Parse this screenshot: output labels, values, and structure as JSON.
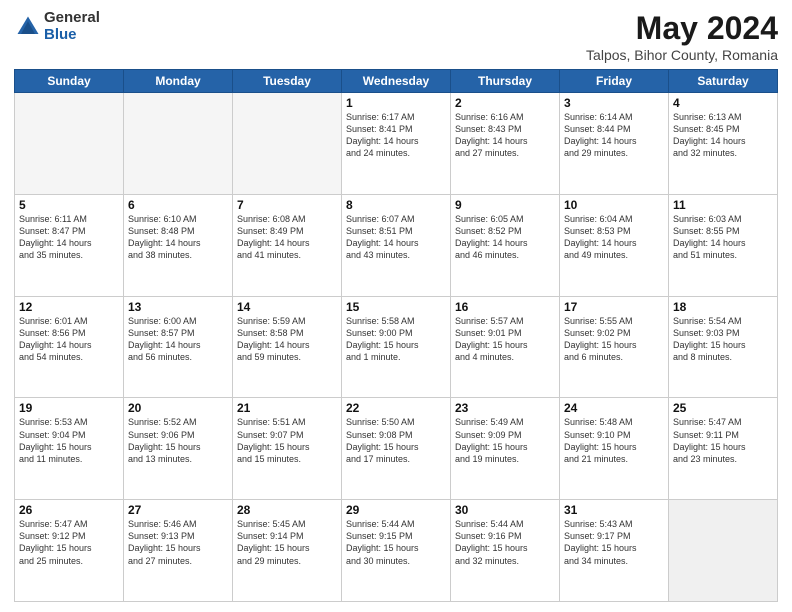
{
  "header": {
    "logo": {
      "general": "General",
      "blue": "Blue"
    },
    "title": "May 2024",
    "location": "Talpos, Bihor County, Romania"
  },
  "weekdays": [
    "Sunday",
    "Monday",
    "Tuesday",
    "Wednesday",
    "Thursday",
    "Friday",
    "Saturday"
  ],
  "weeks": [
    [
      {
        "day": "",
        "info": "",
        "empty": true
      },
      {
        "day": "",
        "info": "",
        "empty": true
      },
      {
        "day": "",
        "info": "",
        "empty": true
      },
      {
        "day": "1",
        "info": "Sunrise: 6:17 AM\nSunset: 8:41 PM\nDaylight: 14 hours\nand 24 minutes.",
        "empty": false
      },
      {
        "day": "2",
        "info": "Sunrise: 6:16 AM\nSunset: 8:43 PM\nDaylight: 14 hours\nand 27 minutes.",
        "empty": false
      },
      {
        "day": "3",
        "info": "Sunrise: 6:14 AM\nSunset: 8:44 PM\nDaylight: 14 hours\nand 29 minutes.",
        "empty": false
      },
      {
        "day": "4",
        "info": "Sunrise: 6:13 AM\nSunset: 8:45 PM\nDaylight: 14 hours\nand 32 minutes.",
        "empty": false
      }
    ],
    [
      {
        "day": "5",
        "info": "Sunrise: 6:11 AM\nSunset: 8:47 PM\nDaylight: 14 hours\nand 35 minutes.",
        "empty": false
      },
      {
        "day": "6",
        "info": "Sunrise: 6:10 AM\nSunset: 8:48 PM\nDaylight: 14 hours\nand 38 minutes.",
        "empty": false
      },
      {
        "day": "7",
        "info": "Sunrise: 6:08 AM\nSunset: 8:49 PM\nDaylight: 14 hours\nand 41 minutes.",
        "empty": false
      },
      {
        "day": "8",
        "info": "Sunrise: 6:07 AM\nSunset: 8:51 PM\nDaylight: 14 hours\nand 43 minutes.",
        "empty": false
      },
      {
        "day": "9",
        "info": "Sunrise: 6:05 AM\nSunset: 8:52 PM\nDaylight: 14 hours\nand 46 minutes.",
        "empty": false
      },
      {
        "day": "10",
        "info": "Sunrise: 6:04 AM\nSunset: 8:53 PM\nDaylight: 14 hours\nand 49 minutes.",
        "empty": false
      },
      {
        "day": "11",
        "info": "Sunrise: 6:03 AM\nSunset: 8:55 PM\nDaylight: 14 hours\nand 51 minutes.",
        "empty": false
      }
    ],
    [
      {
        "day": "12",
        "info": "Sunrise: 6:01 AM\nSunset: 8:56 PM\nDaylight: 14 hours\nand 54 minutes.",
        "empty": false
      },
      {
        "day": "13",
        "info": "Sunrise: 6:00 AM\nSunset: 8:57 PM\nDaylight: 14 hours\nand 56 minutes.",
        "empty": false
      },
      {
        "day": "14",
        "info": "Sunrise: 5:59 AM\nSunset: 8:58 PM\nDaylight: 14 hours\nand 59 minutes.",
        "empty": false
      },
      {
        "day": "15",
        "info": "Sunrise: 5:58 AM\nSunset: 9:00 PM\nDaylight: 15 hours\nand 1 minute.",
        "empty": false
      },
      {
        "day": "16",
        "info": "Sunrise: 5:57 AM\nSunset: 9:01 PM\nDaylight: 15 hours\nand 4 minutes.",
        "empty": false
      },
      {
        "day": "17",
        "info": "Sunrise: 5:55 AM\nSunset: 9:02 PM\nDaylight: 15 hours\nand 6 minutes.",
        "empty": false
      },
      {
        "day": "18",
        "info": "Sunrise: 5:54 AM\nSunset: 9:03 PM\nDaylight: 15 hours\nand 8 minutes.",
        "empty": false
      }
    ],
    [
      {
        "day": "19",
        "info": "Sunrise: 5:53 AM\nSunset: 9:04 PM\nDaylight: 15 hours\nand 11 minutes.",
        "empty": false
      },
      {
        "day": "20",
        "info": "Sunrise: 5:52 AM\nSunset: 9:06 PM\nDaylight: 15 hours\nand 13 minutes.",
        "empty": false
      },
      {
        "day": "21",
        "info": "Sunrise: 5:51 AM\nSunset: 9:07 PM\nDaylight: 15 hours\nand 15 minutes.",
        "empty": false
      },
      {
        "day": "22",
        "info": "Sunrise: 5:50 AM\nSunset: 9:08 PM\nDaylight: 15 hours\nand 17 minutes.",
        "empty": false
      },
      {
        "day": "23",
        "info": "Sunrise: 5:49 AM\nSunset: 9:09 PM\nDaylight: 15 hours\nand 19 minutes.",
        "empty": false
      },
      {
        "day": "24",
        "info": "Sunrise: 5:48 AM\nSunset: 9:10 PM\nDaylight: 15 hours\nand 21 minutes.",
        "empty": false
      },
      {
        "day": "25",
        "info": "Sunrise: 5:47 AM\nSunset: 9:11 PM\nDaylight: 15 hours\nand 23 minutes.",
        "empty": false
      }
    ],
    [
      {
        "day": "26",
        "info": "Sunrise: 5:47 AM\nSunset: 9:12 PM\nDaylight: 15 hours\nand 25 minutes.",
        "empty": false
      },
      {
        "day": "27",
        "info": "Sunrise: 5:46 AM\nSunset: 9:13 PM\nDaylight: 15 hours\nand 27 minutes.",
        "empty": false
      },
      {
        "day": "28",
        "info": "Sunrise: 5:45 AM\nSunset: 9:14 PM\nDaylight: 15 hours\nand 29 minutes.",
        "empty": false
      },
      {
        "day": "29",
        "info": "Sunrise: 5:44 AM\nSunset: 9:15 PM\nDaylight: 15 hours\nand 30 minutes.",
        "empty": false
      },
      {
        "day": "30",
        "info": "Sunrise: 5:44 AM\nSunset: 9:16 PM\nDaylight: 15 hours\nand 32 minutes.",
        "empty": false
      },
      {
        "day": "31",
        "info": "Sunrise: 5:43 AM\nSunset: 9:17 PM\nDaylight: 15 hours\nand 34 minutes.",
        "empty": false
      },
      {
        "day": "",
        "info": "",
        "empty": true
      }
    ]
  ]
}
